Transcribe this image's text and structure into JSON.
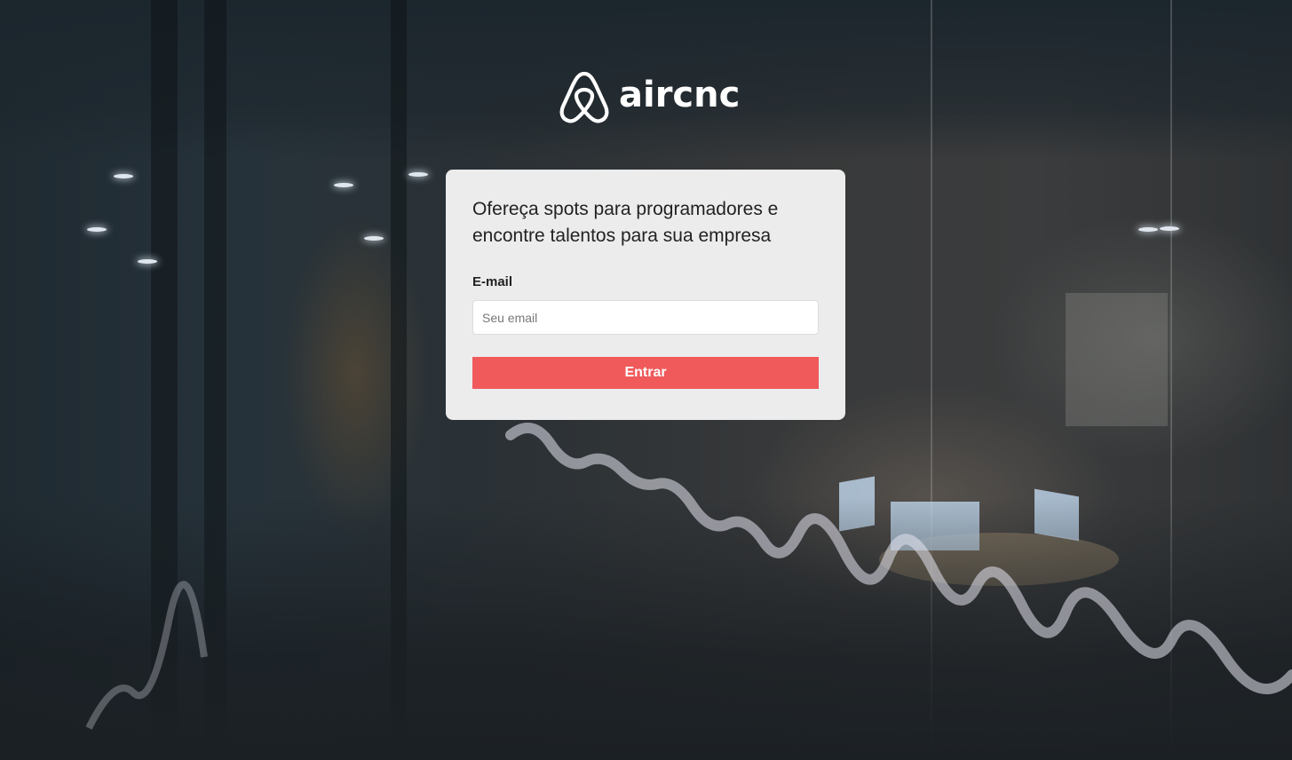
{
  "brand": {
    "logo_icon": "airbnb-belo-icon",
    "name": "aircnc"
  },
  "card": {
    "heading": "Ofereça spots para programadores e encontre talentos para sua empresa",
    "email_label": "E-mail",
    "email_placeholder": "Seu email",
    "email_value": "",
    "submit_label": "Entrar"
  },
  "colors": {
    "accent": "#f05a5b",
    "card_background": "#ececec",
    "text": "#222222"
  },
  "background": {
    "description_icon": "office-photo-background"
  }
}
